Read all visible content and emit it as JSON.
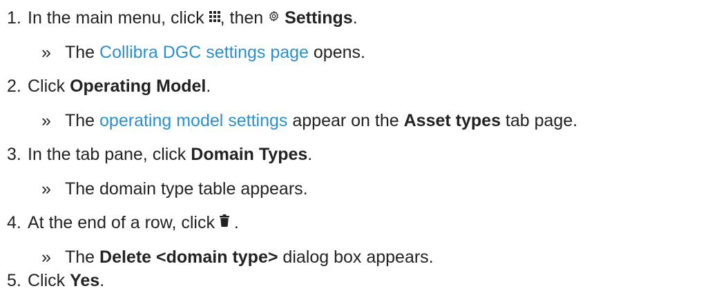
{
  "steps": [
    {
      "number": "1.",
      "text_before_menu_icon": "In the main menu, click ",
      "menu_icon": "grid-icon",
      "text_after_menu_icon": ", then ",
      "settings_icon": "gear-icon",
      "settings_label": "Settings",
      "end_punct": ".",
      "result": {
        "bullet": "»",
        "prefix": "The ",
        "link": "Collibra DGC settings page",
        "suffix": " opens."
      }
    },
    {
      "number": "2.",
      "text": "Click ",
      "bold": "Operating Model",
      "end_punct": ".",
      "result": {
        "bullet": "»",
        "prefix": "The ",
        "link": "operating model settings",
        "middle": " appear on the ",
        "bold": "Asset types",
        "suffix": " tab page."
      }
    },
    {
      "number": "3.",
      "text": "In the tab pane, click ",
      "bold": "Domain Types",
      "end_punct": ".",
      "result": {
        "bullet": "»",
        "text": "The domain type table appears."
      }
    },
    {
      "number": "4.",
      "text": "At the end of a row, click ",
      "icon": "trash-icon",
      "end_punct": " .",
      "result": {
        "bullet": "»",
        "prefix": "The ",
        "bold": "Delete <domain type>",
        "suffix": " dialog box appears."
      }
    },
    {
      "number": "5.",
      "text": "Click ",
      "bold": "Yes",
      "end_punct": "."
    }
  ]
}
